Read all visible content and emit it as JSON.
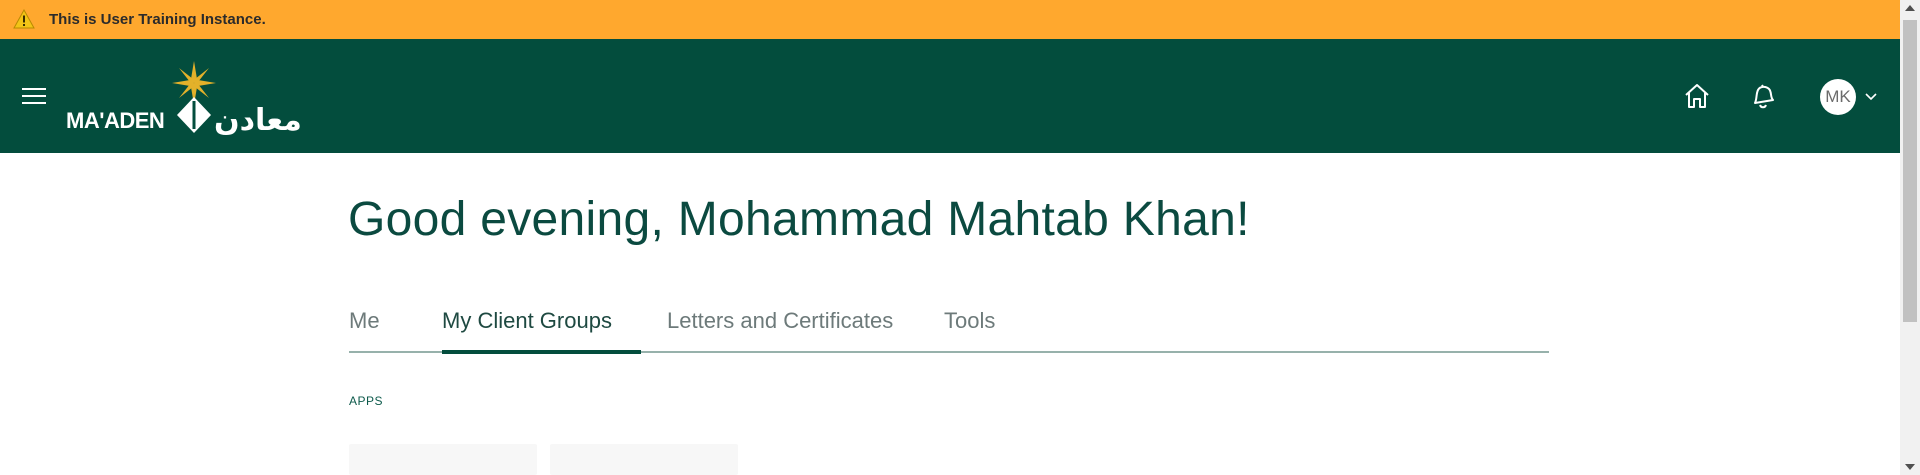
{
  "banner": {
    "text": "This is User Training Instance.",
    "icon": "warning-icon",
    "color": "#ffa82e"
  },
  "header": {
    "brand": "MA'ADEN",
    "brand_arabic": "معادن",
    "background": "#034d3d",
    "icons": [
      "menu-icon",
      "home-icon",
      "notifications-bell-icon"
    ],
    "user_initials": "MK"
  },
  "greeting": "Good evening, Mohammad Mahtab Khan!",
  "tabs": [
    {
      "label": "Me",
      "active": false
    },
    {
      "label": "My Client Groups",
      "active": true
    },
    {
      "label": "Letters and Certificates",
      "active": false
    },
    {
      "label": "Tools",
      "active": false
    }
  ],
  "apps_label": "APPS",
  "colors": {
    "accent": "#034d3d",
    "greeting_text": "#0b4a40",
    "logo_star": "#e3b12a"
  }
}
